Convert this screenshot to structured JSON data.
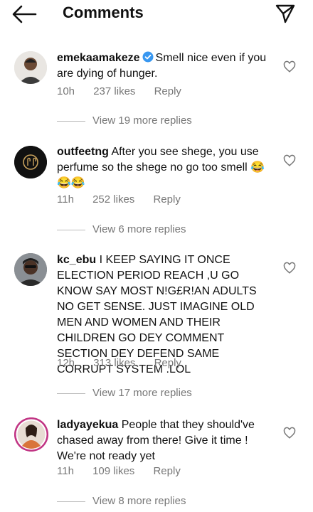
{
  "header": {
    "title": "Comments",
    "back_icon": "arrow-left-icon",
    "send_icon": "paper-plane-icon"
  },
  "comments": [
    {
      "username": "emekaamakeze",
      "verified": true,
      "text": "Smell nice even if you are dying of hunger.",
      "time": "10h",
      "likes": "237 likes",
      "reply": "Reply",
      "view_replies": "View 19 more replies"
    },
    {
      "username": "outfeetng",
      "verified": false,
      "text": "After you see shege, you use perfume so the shege no go too smell 😂😂😂",
      "time": "11h",
      "likes": "252 likes",
      "reply": "Reply",
      "view_replies": "View 6 more replies"
    },
    {
      "username": "kc_ebu",
      "verified": false,
      "text": "I KEEP SAYING IT ONCE ELECTION PERIOD REACH ,U GO KNOW SAY MOST N!G£R!AN ADULTS NO GET SENSE. JUST IMAGINE OLD MEN AND WOMEN AND THEIR CHILDREN GO DEY COMMENT SECTION DEY DEFEND SAME CORRUPT SYSTEM .LOL",
      "time": "12h",
      "likes": "313 likes",
      "reply": "Reply",
      "view_replies": "View 17 more replies"
    },
    {
      "username": "ladyayekua",
      "verified": false,
      "text": "People that they should've chased away from there! Give it time ! We're not ready yet",
      "time": "11h",
      "likes": "109 likes",
      "reply": "Reply",
      "view_replies": "View 8 more replies"
    }
  ],
  "colors": {
    "text": "#111111",
    "muted": "#777777",
    "verified": "#3897f0",
    "story_ring": "#c13584"
  }
}
